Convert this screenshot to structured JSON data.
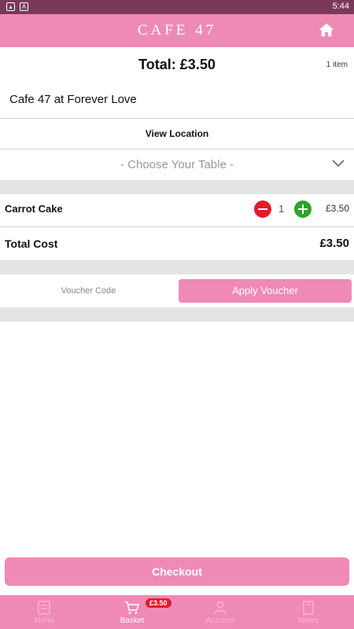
{
  "status_bar": {
    "time": "5:44"
  },
  "header": {
    "title": "CAFE 47"
  },
  "summary": {
    "total": "Total: £3.50",
    "item_count": "1 item"
  },
  "location": {
    "cafe_name": "Cafe 47 at Forever Love",
    "view_location_label": "View Location"
  },
  "table_select": {
    "placeholder": "- Choose Your Table -"
  },
  "basket": {
    "items": [
      {
        "name": "Carrot Cake",
        "quantity": "1",
        "price": "£3.50"
      }
    ],
    "total_label": "Total Cost",
    "total_value": "£3.50"
  },
  "voucher": {
    "placeholder": "Voucher Code",
    "apply_label": "Apply Voucher"
  },
  "checkout_label": "Checkout",
  "bottom_nav": {
    "items": [
      {
        "label": "Menu",
        "icon": "menu-icon"
      },
      {
        "label": "Basket",
        "icon": "basket-icon"
      },
      {
        "label": "Account",
        "icon": "account-icon"
      },
      {
        "label": "Notes",
        "icon": "notes-icon"
      }
    ],
    "basket_badge": "£3.50",
    "active_index": 1
  },
  "colors": {
    "brand_pink": "#ef8ab5",
    "status_bar": "#7a3a57",
    "minus": "#e21c2c",
    "plus": "#2aa52a"
  }
}
